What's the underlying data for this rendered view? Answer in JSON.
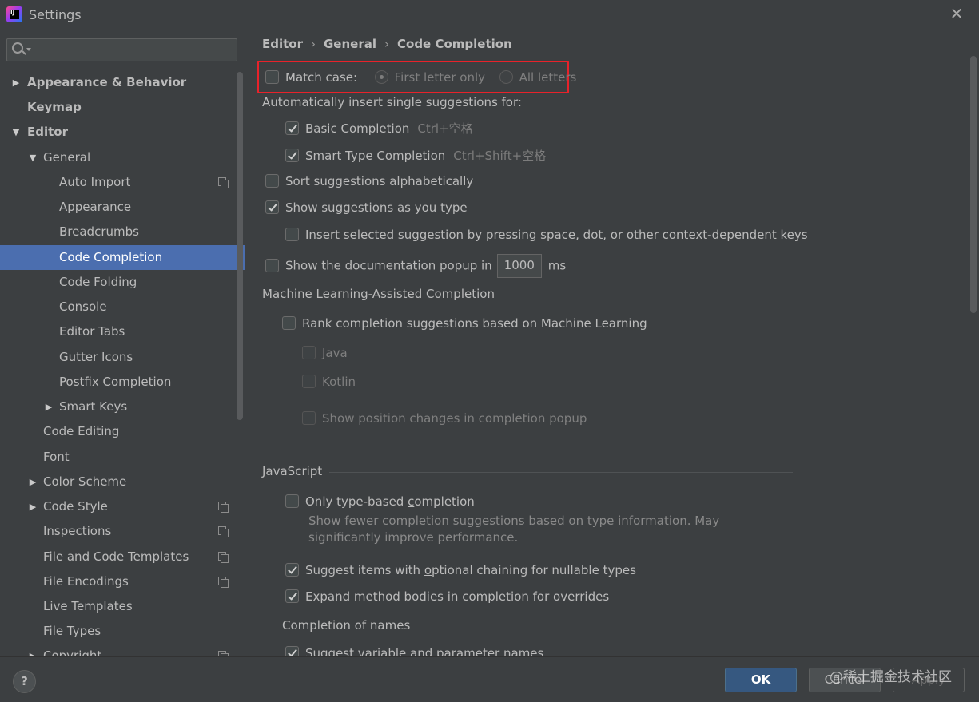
{
  "window": {
    "title": "Settings"
  },
  "search": {
    "placeholder": ""
  },
  "sidebar": {
    "items": [
      {
        "label": "Appearance & Behavior",
        "arrow": "▶"
      },
      {
        "label": "Keymap"
      },
      {
        "label": "Editor",
        "arrow": "▼"
      },
      {
        "label": "General",
        "arrow": "▼"
      },
      {
        "label": "Auto Import"
      },
      {
        "label": "Appearance"
      },
      {
        "label": "Breadcrumbs"
      },
      {
        "label": "Code Completion"
      },
      {
        "label": "Code Folding"
      },
      {
        "label": "Console"
      },
      {
        "label": "Editor Tabs"
      },
      {
        "label": "Gutter Icons"
      },
      {
        "label": "Postfix Completion"
      },
      {
        "label": "Smart Keys",
        "arrow": "▶"
      },
      {
        "label": "Code Editing"
      },
      {
        "label": "Font"
      },
      {
        "label": "Color Scheme",
        "arrow": "▶"
      },
      {
        "label": "Code Style",
        "arrow": "▶"
      },
      {
        "label": "Inspections"
      },
      {
        "label": "File and Code Templates"
      },
      {
        "label": "File Encodings"
      },
      {
        "label": "Live Templates"
      },
      {
        "label": "File Types"
      },
      {
        "label": "Copyright",
        "arrow": "▶"
      }
    ]
  },
  "breadcrumb": [
    "Editor",
    "General",
    "Code Completion"
  ],
  "settings": {
    "match_case": {
      "label": "Match case:",
      "checked": false
    },
    "first_letter": {
      "label": "First letter only",
      "selected": true
    },
    "all_letters": {
      "label": "All letters",
      "selected": false
    },
    "auto_insert_heading": "Automatically insert single suggestions for:",
    "basic_completion": {
      "label": "Basic Completion",
      "shortcut": "Ctrl+空格",
      "checked": true
    },
    "smart_type_completion": {
      "label": "Smart Type Completion",
      "shortcut": "Ctrl+Shift+空格",
      "checked": true
    },
    "sort_alpha": {
      "label": "Sort suggestions alphabetically",
      "checked": false
    },
    "show_as_type": {
      "label": "Show suggestions as you type",
      "checked": true
    },
    "insert_selected": {
      "label": "Insert selected suggestion by pressing space, dot, or other context-dependent keys",
      "checked": false
    },
    "doc_popup": {
      "label": "Show the documentation popup in",
      "value": "1000",
      "unit": "ms",
      "checked": false
    },
    "ml_section": "Machine Learning-Assisted Completion",
    "ml_rank": {
      "label": "Rank completion suggestions based on Machine Learning",
      "checked": false
    },
    "ml_java": {
      "label": "Java",
      "checked": false
    },
    "ml_kotlin": {
      "label": "Kotlin",
      "checked": false
    },
    "ml_position": {
      "label": "Show position changes in completion popup",
      "checked": false
    },
    "js_section": "JavaScript",
    "js_type_based": {
      "label_pre": "Only type-based ",
      "label_mnemonic": "c",
      "label_post": "ompletion",
      "checked": false,
      "help_line1": "Show fewer completion suggestions based on type information. May",
      "help_line2": "significantly improve performance."
    },
    "js_optional_chaining": {
      "label_pre": "Suggest items with ",
      "label_mnemonic": "o",
      "label_post": "ptional chaining for nullable types",
      "checked": true
    },
    "js_expand_bodies": {
      "label": "Expand method bodies in completion for overrides",
      "checked": true
    },
    "names_section": "Completion of names",
    "suggest_var_names": {
      "label": "Suggest variable and parameter names",
      "checked": true
    }
  },
  "buttons": {
    "help": "?",
    "ok": "OK",
    "cancel": "Cancel",
    "apply": "Apply"
  },
  "watermark": "@稀土掘金技术社区",
  "colors": {
    "selection": "#4b6eaf",
    "ok_button": "#365880",
    "highlight_box": "#e8222a",
    "background": "#3c3f41"
  }
}
